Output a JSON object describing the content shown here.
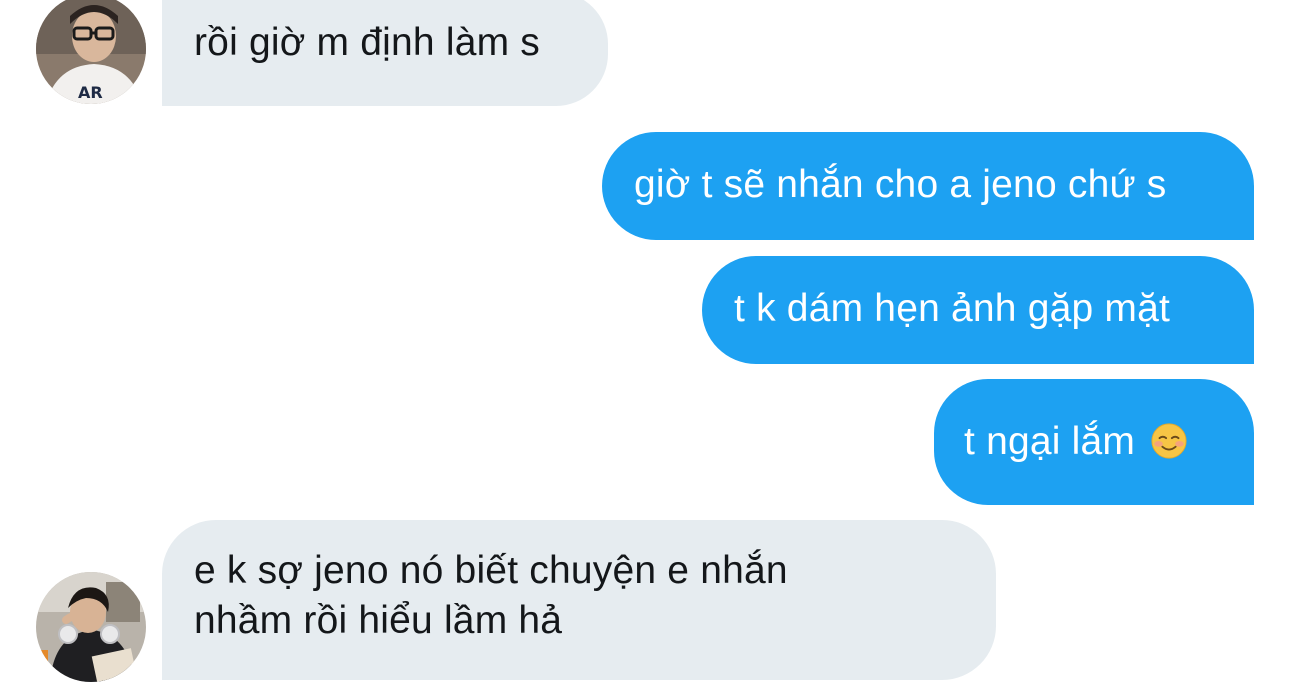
{
  "conversation": {
    "messages": [
      {
        "id": "b1",
        "direction": "incoming",
        "text": "rồi giờ m định làm s",
        "sender_avatar": "avatar-user-glasses"
      },
      {
        "id": "b2",
        "direction": "outgoing",
        "text": "giờ t sẽ nhắn cho a jeno chứ s"
      },
      {
        "id": "b3",
        "direction": "outgoing",
        "text": "t k dám hẹn ảnh gặp mặt"
      },
      {
        "id": "b4",
        "direction": "outgoing",
        "text": "t ngại lắm",
        "emoji": "smiling-face-icon"
      },
      {
        "id": "b5",
        "direction": "incoming",
        "lines": [
          "e k sợ jeno nó biết chuyện e nhắn",
          "nhầm rồi hiểu lầm hả"
        ],
        "sender_avatar": "avatar-user-headphones"
      }
    ]
  },
  "colors": {
    "incoming_bubble": "#e6ecf0",
    "outgoing_bubble": "#1da1f2",
    "incoming_text": "#14171a",
    "outgoing_text": "#ffffff",
    "background": "#ffffff"
  }
}
